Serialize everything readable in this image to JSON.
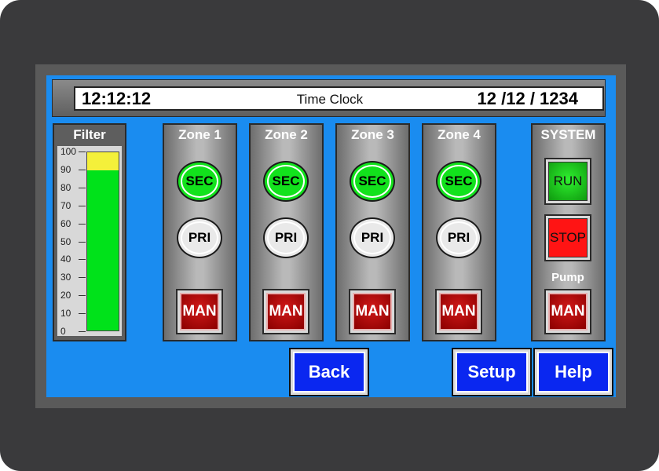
{
  "header": {
    "time": "12:12:12",
    "title": "Time Clock",
    "date": "12 /12 / 1234"
  },
  "filter": {
    "title": "Filter",
    "scale_labels": [
      "100",
      "90",
      "80",
      "70",
      "60",
      "50",
      "40",
      "30",
      "20",
      "10",
      "0"
    ],
    "level_percent": 90,
    "alarm_band_percent": [
      90,
      100
    ],
    "colors": {
      "level": "#00e21a",
      "alarm_band": "#f4f03a"
    }
  },
  "zones": [
    {
      "title": "Zone 1",
      "sec_label": "SEC",
      "pri_label": "PRI",
      "man_label": "MAN"
    },
    {
      "title": "Zone 2",
      "sec_label": "SEC",
      "pri_label": "PRI",
      "man_label": "MAN"
    },
    {
      "title": "Zone 3",
      "sec_label": "SEC",
      "pri_label": "PRI",
      "man_label": "MAN"
    },
    {
      "title": "Zone 4",
      "sec_label": "SEC",
      "pri_label": "PRI",
      "man_label": "MAN"
    }
  ],
  "system": {
    "title": "SYSTEM",
    "run_label": "RUN",
    "stop_label": "STOP",
    "pump_label": "Pump",
    "man_label": "MAN"
  },
  "nav": {
    "back_label": "Back",
    "setup_label": "Setup",
    "help_label": "Help"
  },
  "colors": {
    "screen_bg": "#1a8cf0",
    "lamp_on": "#12e21c",
    "lamp_off": "#e9e9e9",
    "man_button": "#c00000",
    "run": "#18c818",
    "stop": "#ff1414",
    "nav_button": "#0a27f0"
  }
}
